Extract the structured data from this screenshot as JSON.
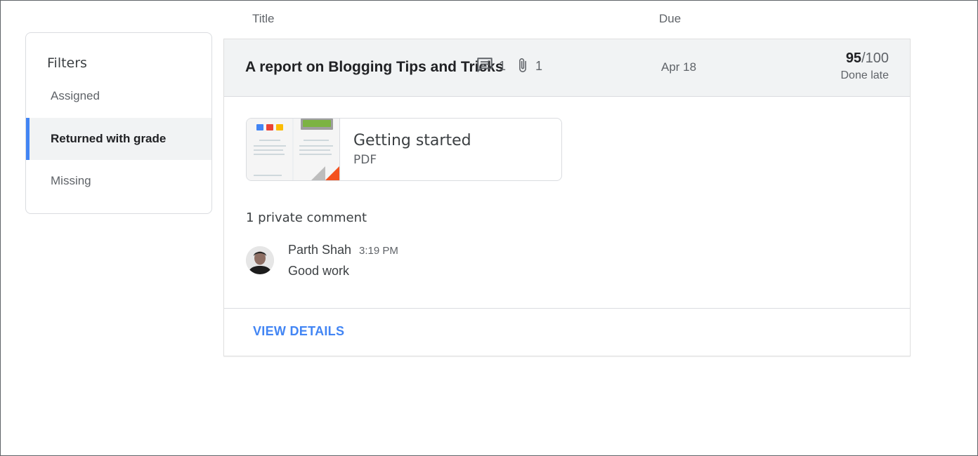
{
  "columns": {
    "title": "Title",
    "due": "Due"
  },
  "filters": {
    "heading": "Filters",
    "items": [
      {
        "label": "Assigned",
        "active": false
      },
      {
        "label": "Returned with grade",
        "active": true
      },
      {
        "label": "Missing",
        "active": false
      }
    ]
  },
  "assignment": {
    "title": "A report on Blogging Tips and Tricks",
    "comment_count": "1",
    "attachment_count": "1",
    "due": "Apr 18",
    "score": "95",
    "max_score": "/100",
    "status": "Done late",
    "attachment": {
      "name": "Getting started",
      "type": "PDF",
      "icon": "pdf-icon"
    },
    "comments_heading": "1 private comment",
    "comment": {
      "author": "Parth Shah",
      "time": "3:19 PM",
      "text": "Good work"
    },
    "view_details": "VIEW DETAILS"
  },
  "colors": {
    "accent": "#4285f4",
    "pdf": "#f4511e",
    "header_bg": "#f1f3f4"
  }
}
